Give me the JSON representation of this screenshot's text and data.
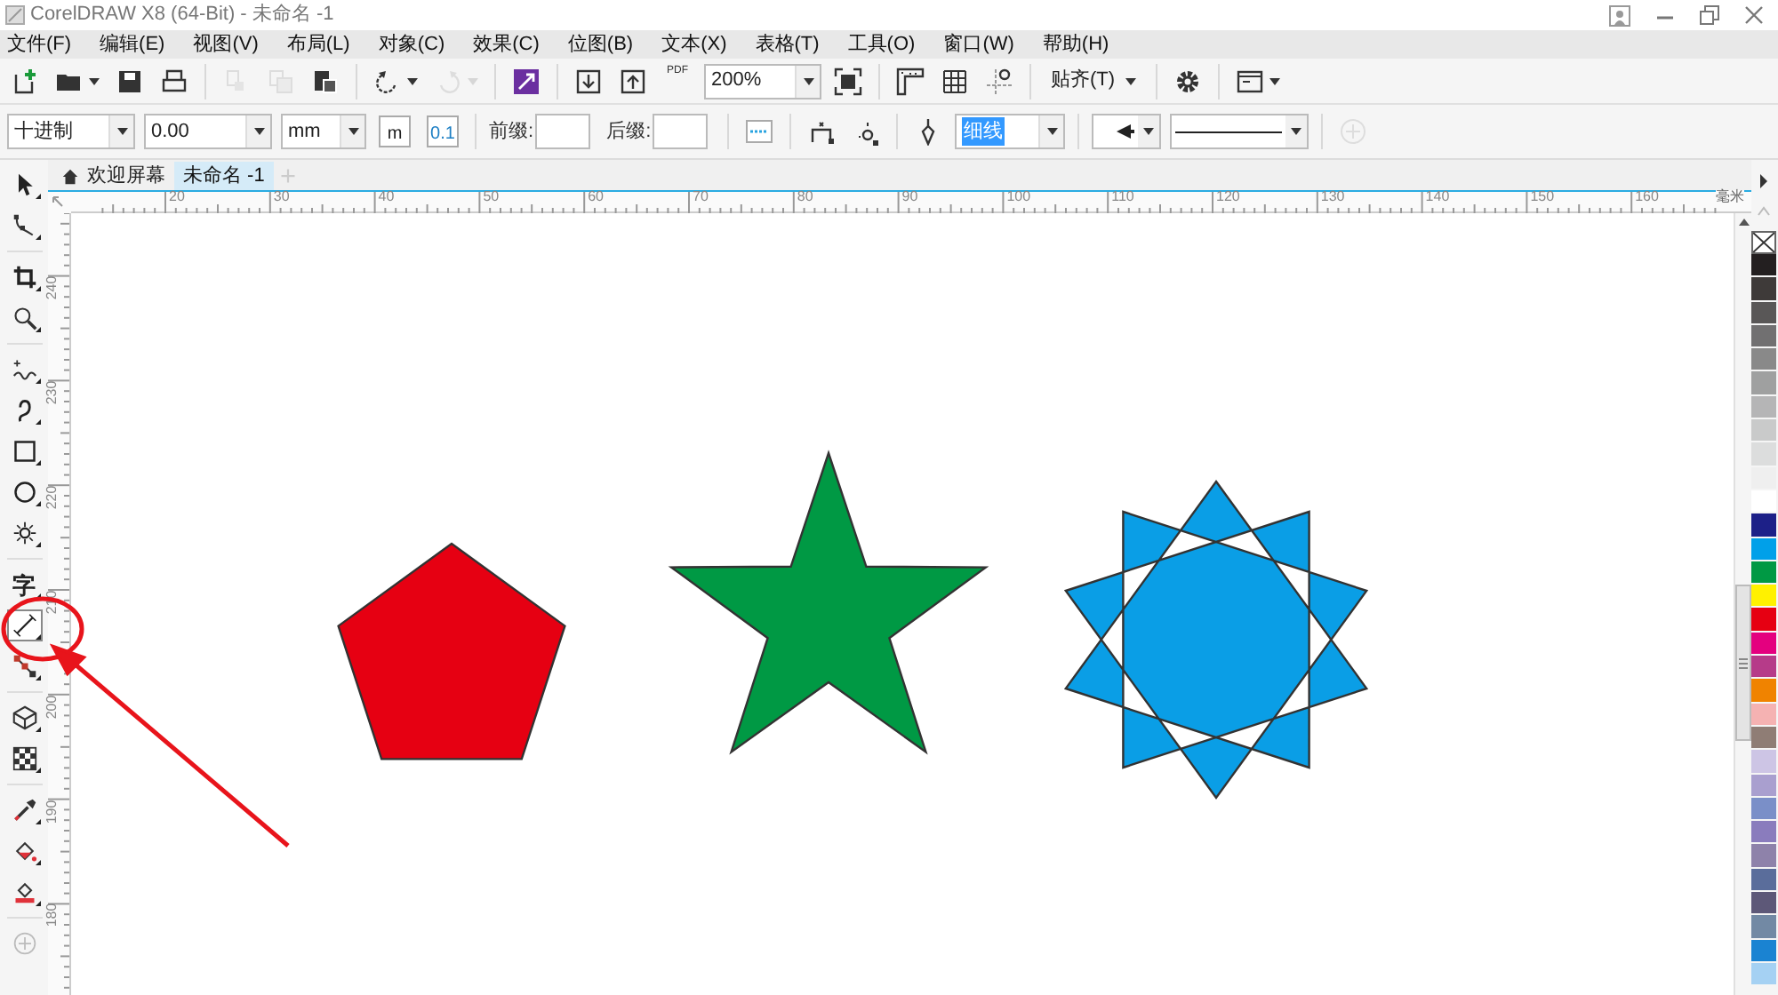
{
  "window": {
    "title": "CorelDRAW X8 (64-Bit) - 未命名 -1"
  },
  "menu": [
    "文件(F)",
    "编辑(E)",
    "视图(V)",
    "布局(L)",
    "对象(C)",
    "效果(C)",
    "位图(B)",
    "文本(X)",
    "表格(T)",
    "工具(O)",
    "窗口(W)",
    "帮助(H)"
  ],
  "standard_toolbar": [
    {
      "kind": "new",
      "disabled": false,
      "caret": false
    },
    {
      "kind": "open",
      "disabled": false,
      "caret": true
    },
    {
      "kind": "save",
      "disabled": false,
      "caret": false
    },
    {
      "kind": "print",
      "disabled": false,
      "caret": false
    },
    {
      "kind": "sep"
    },
    {
      "kind": "cut",
      "disabled": true,
      "caret": false
    },
    {
      "kind": "copy",
      "disabled": true,
      "caret": false
    },
    {
      "kind": "paste",
      "disabled": false,
      "caret": false
    },
    {
      "kind": "sep"
    },
    {
      "kind": "undo",
      "disabled": false,
      "caret": true
    },
    {
      "kind": "redo",
      "disabled": true,
      "caret": true
    },
    {
      "kind": "sep"
    },
    {
      "kind": "launcher",
      "disabled": false,
      "caret": false
    },
    {
      "kind": "sep"
    },
    {
      "kind": "import",
      "disabled": false,
      "caret": false
    },
    {
      "kind": "export",
      "disabled": false,
      "caret": false
    },
    {
      "kind": "pdf",
      "label": "PDF",
      "disabled": false,
      "caret": false
    },
    {
      "kind": "combo",
      "value": "200%",
      "highlighted": false
    },
    {
      "kind": "fullscreen",
      "disabled": false,
      "caret": false
    },
    {
      "kind": "sep"
    },
    {
      "kind": "rulers",
      "disabled": false,
      "caret": false
    },
    {
      "kind": "grid",
      "disabled": false,
      "caret": false
    },
    {
      "kind": "guides",
      "disabled": false,
      "caret": false
    },
    {
      "kind": "sep"
    },
    {
      "kind": "text",
      "label": "贴齐(T)",
      "caret": true
    },
    {
      "kind": "sep"
    },
    {
      "kind": "gear",
      "disabled": false,
      "caret": false
    },
    {
      "kind": "sep"
    },
    {
      "kind": "window",
      "disabled": false,
      "caret": true
    }
  ],
  "property_bar": [
    {
      "kind": "combo",
      "value": "十进制",
      "highlighted": false
    },
    {
      "kind": "combo",
      "value": "0.00",
      "highlighted": false
    },
    {
      "kind": "combo",
      "value": "mm",
      "highlighted": false
    },
    {
      "kind": "units",
      "label": "m",
      "disabled": false,
      "caret": false
    },
    {
      "kind": "precision",
      "label": "0.1",
      "disabled": false,
      "caret": false
    },
    {
      "kind": "sep"
    },
    {
      "kind": "field",
      "label": "前缀:"
    },
    {
      "kind": "field",
      "label": "后缀:"
    },
    {
      "kind": "sep"
    },
    {
      "kind": "dimtext",
      "disabled": false,
      "caret": false
    },
    {
      "kind": "sep"
    },
    {
      "kind": "extension",
      "disabled": false,
      "caret": false
    },
    {
      "kind": "textpos",
      "disabled": false,
      "caret": false
    },
    {
      "kind": "sep"
    },
    {
      "kind": "pen",
      "disabled": false,
      "caret": false
    },
    {
      "kind": "combo",
      "value": "细线",
      "highlighted": true
    },
    {
      "kind": "sep"
    },
    {
      "kind": "arrowcombo"
    },
    {
      "kind": "linecombo"
    },
    {
      "kind": "sep"
    },
    {
      "kind": "plus",
      "disabled": true,
      "caret": false
    }
  ],
  "tabs": [
    {
      "label": "欢迎屏幕",
      "kind": "home",
      "selected": false
    },
    {
      "label": "未命名 -1",
      "kind": "document",
      "selected": true
    }
  ],
  "toolbox": [
    {
      "kind": "pick",
      "selected": false
    },
    {
      "kind": "shape",
      "selected": false
    },
    {
      "kind": "sep"
    },
    {
      "kind": "crop",
      "selected": false
    },
    {
      "kind": "zoom",
      "selected": false
    },
    {
      "kind": "sep"
    },
    {
      "kind": "freehand",
      "selected": false
    },
    {
      "kind": "artistic",
      "selected": false
    },
    {
      "kind": "rectangle",
      "selected": false
    },
    {
      "kind": "ellipse",
      "selected": false
    },
    {
      "kind": "polygon",
      "selected": false
    },
    {
      "kind": "sep"
    },
    {
      "kind": "text",
      "label": "字",
      "selected": false
    },
    {
      "kind": "dimension",
      "selected": true
    },
    {
      "kind": "connector",
      "selected": false
    },
    {
      "kind": "sep"
    },
    {
      "kind": "cube",
      "selected": false
    },
    {
      "kind": "transparency",
      "selected": false
    },
    {
      "kind": "sep"
    },
    {
      "kind": "eyedropper",
      "selected": false
    },
    {
      "kind": "fill",
      "selected": false
    },
    {
      "kind": "outline",
      "selected": false
    },
    {
      "kind": "sep"
    },
    {
      "kind": "plus",
      "selected": false
    }
  ],
  "ruler": {
    "horizontal": [
      "20",
      "30",
      "40",
      "50",
      "60",
      "70",
      "80",
      "90",
      "100",
      "110",
      "120",
      "130",
      "140",
      "150",
      "160"
    ],
    "unit": "毫米",
    "vertical": [
      "240",
      "230",
      "220",
      "210",
      "200",
      "190",
      "180"
    ]
  },
  "canvas": {
    "shapes": [
      {
        "kind": "pentagon",
        "color": "#e60012"
      },
      {
        "kind": "star",
        "color": "#009944"
      },
      {
        "kind": "star10",
        "color": "#0a9ee6"
      }
    ]
  },
  "palette": [
    {
      "kind": "none"
    },
    {
      "color": "#231f20"
    },
    {
      "color": "#3e3a39"
    },
    {
      "color": "#595757"
    },
    {
      "color": "#717071"
    },
    {
      "color": "#898989"
    },
    {
      "color": "#9fa0a0"
    },
    {
      "color": "#b5b5b6"
    },
    {
      "color": "#c9caca"
    },
    {
      "color": "#dcdddd"
    },
    {
      "color": "#efefef"
    },
    {
      "color": "#ffffff"
    },
    {
      "color": "#1d2088"
    },
    {
      "color": "#00a0e9"
    },
    {
      "color": "#009944"
    },
    {
      "color": "#fff100"
    },
    {
      "color": "#e60012"
    },
    {
      "color": "#e4007f"
    },
    {
      "color": "#b63b89"
    },
    {
      "color": "#f08300"
    },
    {
      "color": "#f5b2b2"
    },
    {
      "color": "#8f7d75"
    },
    {
      "color": "#cdc5e5"
    },
    {
      "color": "#a99fcf"
    },
    {
      "color": "#7a8fc8"
    },
    {
      "color": "#8a7cbd"
    },
    {
      "color": "#8e82aa"
    },
    {
      "color": "#5a6d9b"
    },
    {
      "color": "#5d5878"
    },
    {
      "color": "#7289a4"
    },
    {
      "color": "#1a83d2"
    },
    {
      "color": "#a5d1f3"
    }
  ]
}
